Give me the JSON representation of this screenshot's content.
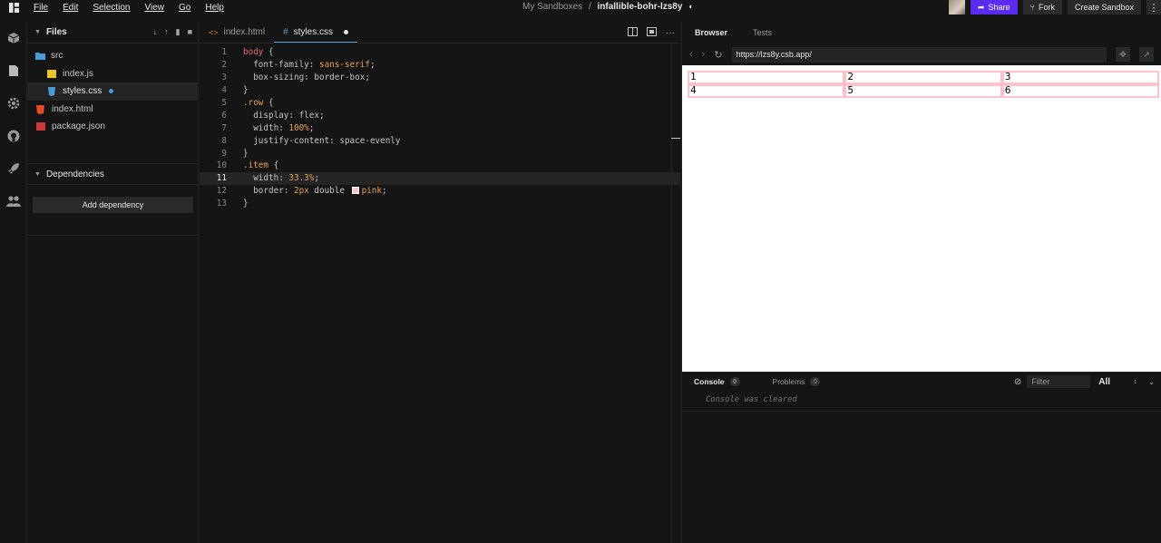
{
  "menu": [
    "File",
    "Edit",
    "Selection",
    "View",
    "Go",
    "Help"
  ],
  "breadcrumb": {
    "parent": "My Sandboxes",
    "separator": "/",
    "name": "infallible-bohr-lzs8y"
  },
  "header_buttons": {
    "share": "Share",
    "fork": "Fork",
    "create": "Create Sandbox",
    "more": "⋮"
  },
  "sidebar": {
    "files_label": "Files",
    "tree": [
      {
        "label": "src",
        "type": "folder"
      },
      {
        "label": "index.js",
        "type": "js"
      },
      {
        "label": "styles.css",
        "type": "css"
      },
      {
        "label": "index.html",
        "type": "html"
      },
      {
        "label": "package.json",
        "type": "json"
      }
    ],
    "deps_label": "Dependencies",
    "add_dependency": "Add dependency"
  },
  "editor": {
    "tabs": [
      {
        "label": "index.html",
        "icon": "<>"
      },
      {
        "label": "styles.css",
        "icon": "#"
      }
    ],
    "line_numbers": [
      "1",
      "2",
      "3",
      "4",
      "5",
      "6",
      "7",
      "8",
      "9",
      "10",
      "11",
      "12",
      "13"
    ],
    "code": {
      "l1_sel": "body",
      "l1_brace": " {",
      "l2_prop": "  font-family",
      "l2_val": "sans-serif",
      "l3_prop": "  box-sizing",
      "l3_val": "border-box",
      "l4": "}",
      "l5_sel": ".row",
      "l5_brace": " {",
      "l6_prop": "  display",
      "l6_val": "flex",
      "l7_prop": "  width",
      "l7_val": "100%",
      "l8_prop": "  justify-content",
      "l8_val": "space-evenly",
      "l9": "}",
      "l10_sel": ".item",
      "l10_brace": " {",
      "l11_prop": "  width",
      "l11_val": "33.3%",
      "l12_prop": "  border",
      "l12_v1": "2px",
      "l12_v2": " double ",
      "l12_v3": "pink",
      "l13": "}"
    }
  },
  "preview": {
    "tabs": [
      "Browser",
      "Tests"
    ],
    "url": "https://lzs8y.csb.app/",
    "rows": [
      [
        "1",
        "2",
        "3"
      ],
      [
        "4",
        "5",
        "6"
      ]
    ],
    "accent_border": "#ffc0cb"
  },
  "console": {
    "tab_console": "Console",
    "console_count": "0",
    "tab_problems": "Problems",
    "problems_count": "0",
    "filter_placeholder": "Filter",
    "level": "All",
    "message": "Console was cleared"
  }
}
